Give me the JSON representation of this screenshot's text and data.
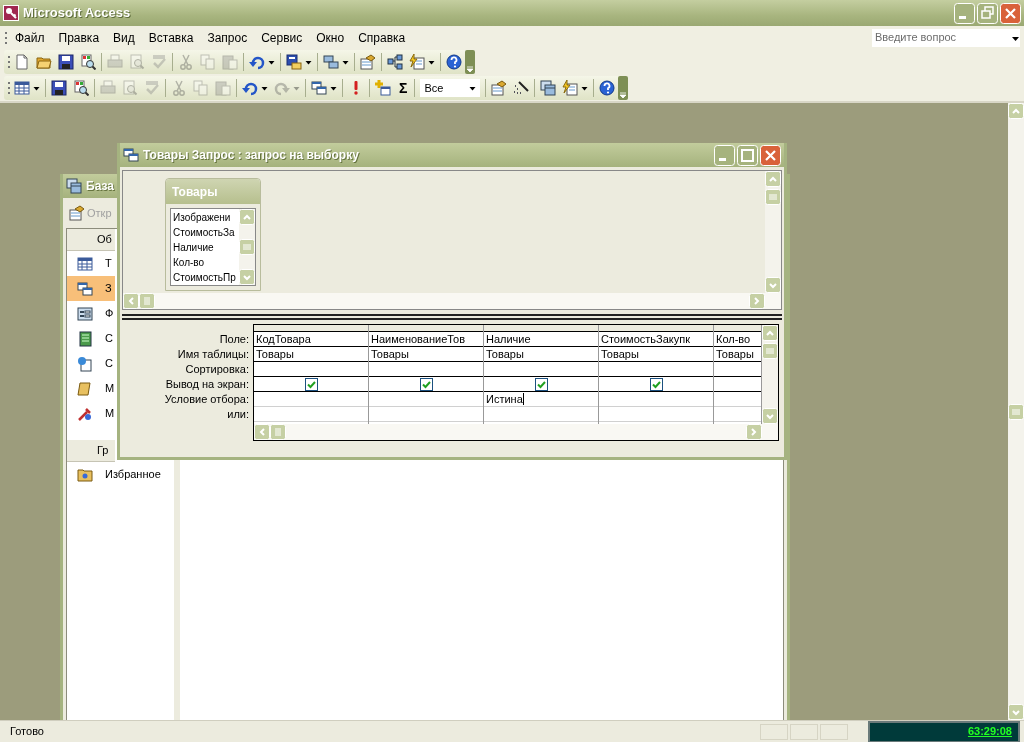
{
  "window": {
    "title": "Microsoft Access"
  },
  "menu": [
    {
      "label": "Файл"
    },
    {
      "label": "Правка"
    },
    {
      "label": "Вид"
    },
    {
      "label": "Вставка"
    },
    {
      "label": "Запрос"
    },
    {
      "label": "Сервис"
    },
    {
      "label": "Окно"
    },
    {
      "label": "Справка"
    }
  ],
  "help_search": {
    "placeholder": "Введите вопрос"
  },
  "toolbars": [
    {
      "items": [
        {
          "kind": "button",
          "disabled": false
        },
        {
          "kind": "button",
          "disabled": false
        },
        {
          "kind": "button",
          "disabled": false
        },
        {
          "kind": "button",
          "disabled": false
        },
        {
          "kind": "separator"
        },
        {
          "kind": "button",
          "disabled": true
        },
        {
          "kind": "button",
          "disabled": true
        },
        {
          "kind": "button",
          "disabled": true
        },
        {
          "kind": "separator"
        },
        {
          "kind": "button",
          "disabled": true
        },
        {
          "kind": "button",
          "disabled": true
        },
        {
          "kind": "button",
          "disabled": true
        },
        {
          "kind": "separator"
        },
        {
          "kind": "dropdown",
          "disabled": false
        },
        {
          "kind": "separator"
        },
        {
          "kind": "dropdown",
          "disabled": false
        },
        {
          "kind": "separator"
        },
        {
          "kind": "dropdown",
          "disabled": false
        },
        {
          "kind": "separator"
        },
        {
          "kind": "button",
          "disabled": false
        },
        {
          "kind": "separator"
        },
        {
          "kind": "button",
          "disabled": false
        },
        {
          "kind": "dropdown",
          "disabled": false
        },
        {
          "kind": "separator"
        },
        {
          "kind": "button",
          "disabled": false
        }
      ]
    },
    {
      "items": [
        {
          "kind": "dropdown",
          "disabled": false
        },
        {
          "kind": "separator"
        },
        {
          "kind": "button",
          "disabled": false
        },
        {
          "kind": "button",
          "disabled": false
        },
        {
          "kind": "separator"
        },
        {
          "kind": "button",
          "disabled": true
        },
        {
          "kind": "button",
          "disabled": true
        },
        {
          "kind": "button",
          "disabled": true
        },
        {
          "kind": "separator"
        },
        {
          "kind": "button",
          "disabled": true
        },
        {
          "kind": "button",
          "disabled": true
        },
        {
          "kind": "button",
          "disabled": true
        },
        {
          "kind": "separator"
        },
        {
          "kind": "dropdown",
          "disabled": false
        },
        {
          "kind": "dropdown",
          "disabled": true
        },
        {
          "kind": "separator"
        },
        {
          "kind": "dropdown",
          "disabled": false
        },
        {
          "kind": "separator"
        },
        {
          "kind": "button",
          "disabled": false
        },
        {
          "kind": "separator"
        },
        {
          "kind": "button",
          "disabled": false
        },
        {
          "kind": "symbol",
          "label": "Σ"
        },
        {
          "kind": "separator"
        },
        {
          "kind": "combo",
          "value": "Все"
        },
        {
          "kind": "separator"
        },
        {
          "kind": "button",
          "disabled": false
        },
        {
          "kind": "button",
          "disabled": false
        },
        {
          "kind": "separator"
        },
        {
          "kind": "button",
          "disabled": false
        },
        {
          "kind": "dropdown",
          "disabled": false
        },
        {
          "kind": "separator"
        },
        {
          "kind": "button",
          "disabled": false
        }
      ]
    }
  ],
  "database_window": {
    "title": "База",
    "toolbar_button": {
      "label": "Откр",
      "disabled": true
    },
    "objects_header": "Об",
    "objects": [
      {
        "label": "Т",
        "selected": false
      },
      {
        "label": "З",
        "selected": true
      },
      {
        "label": "Ф",
        "selected": false
      },
      {
        "label": "С",
        "selected": false
      },
      {
        "label": "С",
        "selected": false
      },
      {
        "label": "М",
        "selected": false
      },
      {
        "label": "М",
        "selected": false
      }
    ],
    "groups_header": "Гр",
    "groups": [
      {
        "label": "Избранное"
      }
    ]
  },
  "query_window": {
    "title": "Товары Запрос : запрос на выборку",
    "table": {
      "title": "Товары",
      "fields": [
        "Изображени",
        "СтоимостьЗа",
        "Наличие",
        "Кол-во",
        "СтоимостьПр"
      ]
    },
    "grid": {
      "row_labels": [
        "Поле:",
        "Имя таблицы:",
        "Сортировка:",
        "Вывод на экран:",
        "Условие отбора:",
        "или:"
      ],
      "columns": [
        {
          "field": "КодТовара",
          "table": "Товары",
          "show": true,
          "focused": false
        },
        {
          "field": "НаименованиеТов",
          "table": "Товары",
          "show": true,
          "focused": false
        },
        {
          "field": "Наличие",
          "table": "Товары",
          "show": true,
          "criteria": "Истина",
          "focused": true
        },
        {
          "field": "СтоимостьЗакупк",
          "table": "Товары",
          "show": true,
          "focused": false
        },
        {
          "field": "Кол-во",
          "table": "Товары",
          "focused": false
        }
      ]
    }
  },
  "status_bar": {
    "text": "Готово",
    "clock": "63:29:08"
  }
}
